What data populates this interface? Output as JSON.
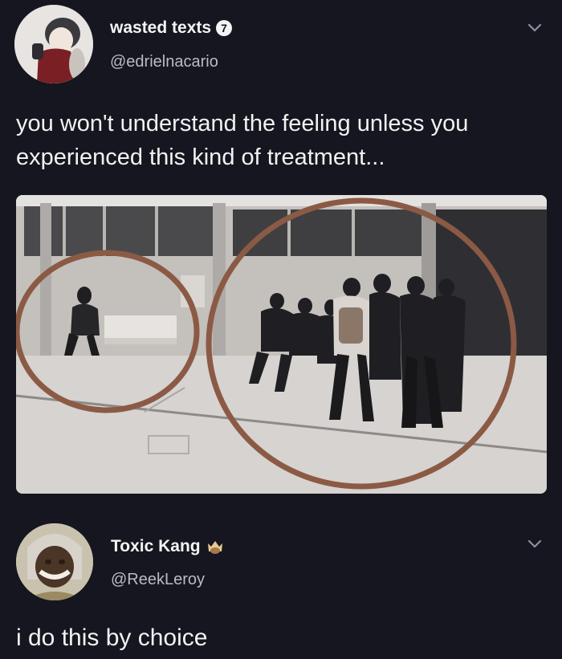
{
  "tweets": [
    {
      "display_name": "wasted texts",
      "verified_badge": "7",
      "handle": "@edrielnacario",
      "text": "you won't understand the feeling unless you experienced this kind of treatment...",
      "icons": {
        "avatar": "anime-avatar",
        "menu": "chevron-down-icon"
      }
    },
    {
      "display_name": "Toxic Kang",
      "handle": "@ReekLeroy",
      "text": "i do this by choice",
      "icons": {
        "avatar": "person-avatar",
        "badge": "crown-emoji-icon",
        "menu": "chevron-down-icon"
      }
    }
  ],
  "colors": {
    "background": "#15161f",
    "text": "#f2f2f2",
    "handle": "#b9bcc4",
    "circle": "#8b5a45"
  }
}
